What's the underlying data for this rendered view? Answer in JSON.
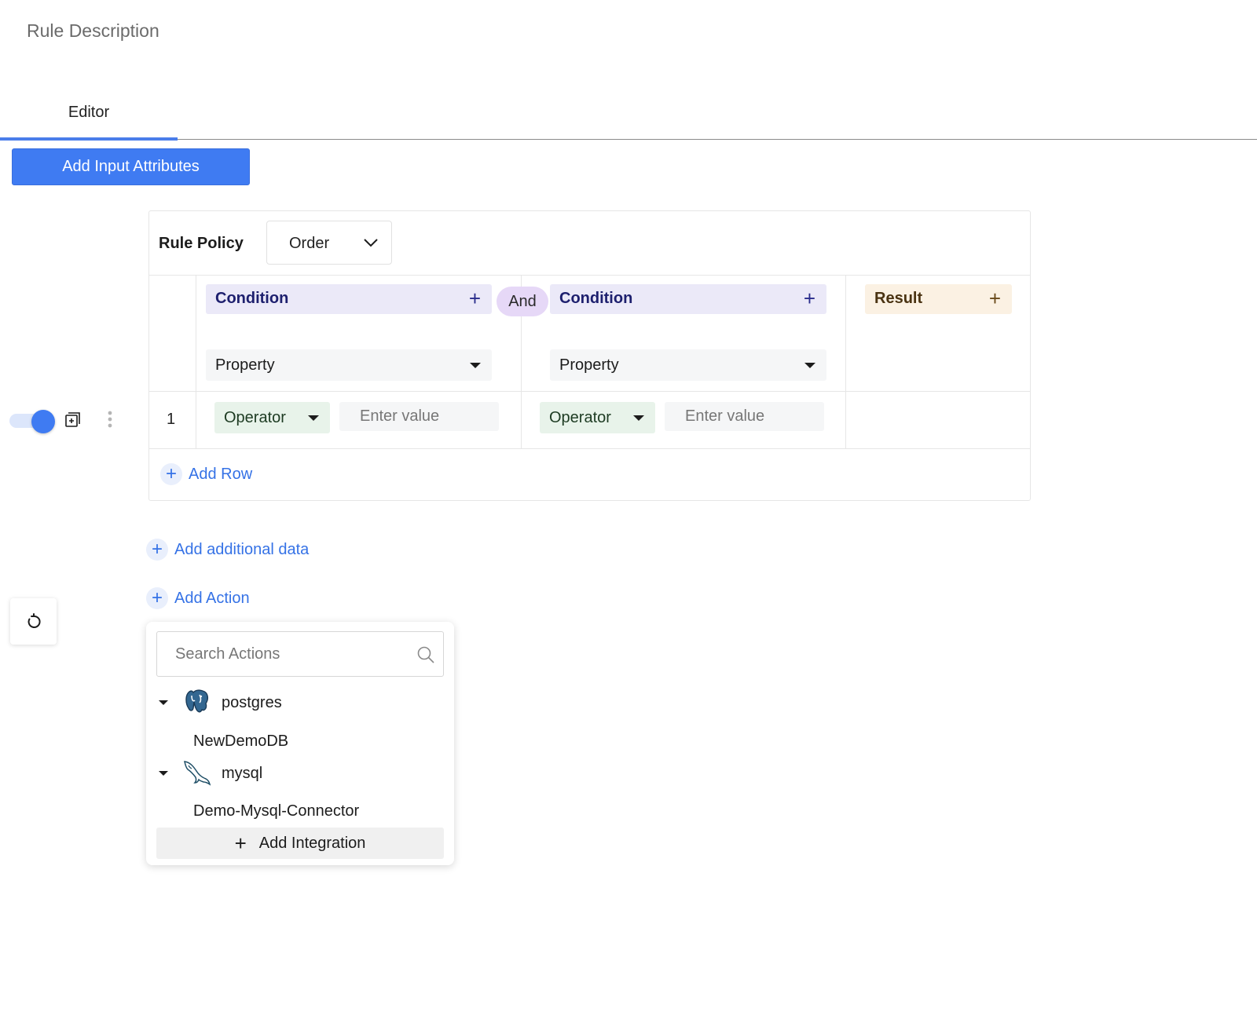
{
  "header": {
    "rule_description": "Rule Description"
  },
  "tabs": [
    {
      "label": "Editor",
      "active": true
    }
  ],
  "toolbar": {
    "add_input_attributes": "Add Input Attributes"
  },
  "rule_table": {
    "policy_label": "Rule Policy",
    "policy_value": "Order",
    "columns": [
      {
        "type": "condition",
        "label": "Condition",
        "add": "+",
        "property": "Property"
      },
      {
        "type": "condition",
        "label": "Condition",
        "add": "+",
        "property": "Property"
      },
      {
        "type": "result",
        "label": "Result",
        "add": "+"
      }
    ],
    "connector": "And",
    "rows": [
      {
        "number": "1",
        "enabled": true,
        "cells": [
          {
            "operator": "Operator",
            "value_placeholder": "Enter value"
          },
          {
            "operator": "Operator",
            "value_placeholder": "Enter value"
          }
        ]
      }
    ],
    "add_row": "Add Row"
  },
  "links": {
    "add_additional_data": "Add additional data",
    "add_action": "Add Action"
  },
  "actions_dropdown": {
    "search_placeholder": "Search Actions",
    "groups": [
      {
        "name": "postgres",
        "icon": "postgres-elephant-icon",
        "children": [
          "NewDemoDB"
        ]
      },
      {
        "name": "mysql",
        "icon": "mysql-dolphin-icon",
        "children": [
          "Demo-Mysql-Connector"
        ]
      }
    ],
    "add_integration": "Add Integration"
  },
  "colors": {
    "primary": "#3f7bf2",
    "condition_header": "#ebe9f8",
    "result_header": "#fbf1e3",
    "operator_bg": "#e8f3ea",
    "and_pill": "#e6d8f7"
  }
}
